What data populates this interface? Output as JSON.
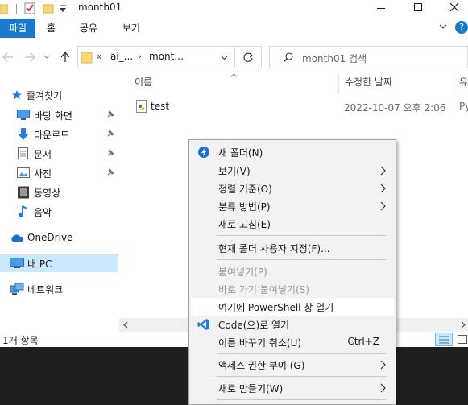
{
  "window": {
    "title": "month01",
    "ribbon_tabs": [
      "파일",
      "홈",
      "공유",
      "보기"
    ]
  },
  "address": {
    "breadcrumb_prefix": "«",
    "crumb_1": "ai_...",
    "crumb_sep": "›",
    "crumb_2": "mont...",
    "search_placeholder": "month01 검색"
  },
  "nav": {
    "quick_access": "즐겨찾기",
    "items": [
      "바탕 화면",
      "다운로드",
      "문서",
      "사진",
      "동영상",
      "음악"
    ],
    "onedrive": "OneDrive",
    "this_pc": "내 PC",
    "network": "네트워크"
  },
  "columns": {
    "name": "이름",
    "modified": "수정한 날짜",
    "type_partial": "유"
  },
  "files": [
    {
      "name": "test",
      "modified": "2022-10-07 오후 2:06",
      "type_partial": "Py"
    }
  ],
  "status": {
    "item_count": "1개 항목"
  },
  "context_menu": {
    "items": [
      {
        "label": "새 폴더(N)",
        "icon": "new-folder-icon"
      },
      {
        "label": "보기(V)",
        "submenu": true
      },
      {
        "label": "정렬 기준(O)",
        "submenu": true
      },
      {
        "label": "분류 방법(P)",
        "submenu": true
      },
      {
        "label": "새로 고침(E)"
      },
      {
        "label": "현재 폴더 사용자 지정(F)..."
      },
      {
        "label": "붙여넣기(P)",
        "disabled": true
      },
      {
        "label": "바로 가기 붙여넣기(S)",
        "disabled": true
      },
      {
        "label": "여기에 PowerShell 창 열기",
        "hover": true
      },
      {
        "label": "Code(으)로 열기",
        "icon": "vscode-icon"
      },
      {
        "label": "이름 바꾸기 취소(U)",
        "shortcut": "Ctrl+Z"
      },
      {
        "label": "액세스 권한 부여 (G)",
        "submenu": true
      },
      {
        "label": "새로 만들기(W)",
        "submenu": true
      }
    ]
  },
  "colors": {
    "accent": "#1979ca",
    "selection": "#cce8ff",
    "menu_bg": "#f2f2f2",
    "taskbar": "#1f1f1f"
  }
}
